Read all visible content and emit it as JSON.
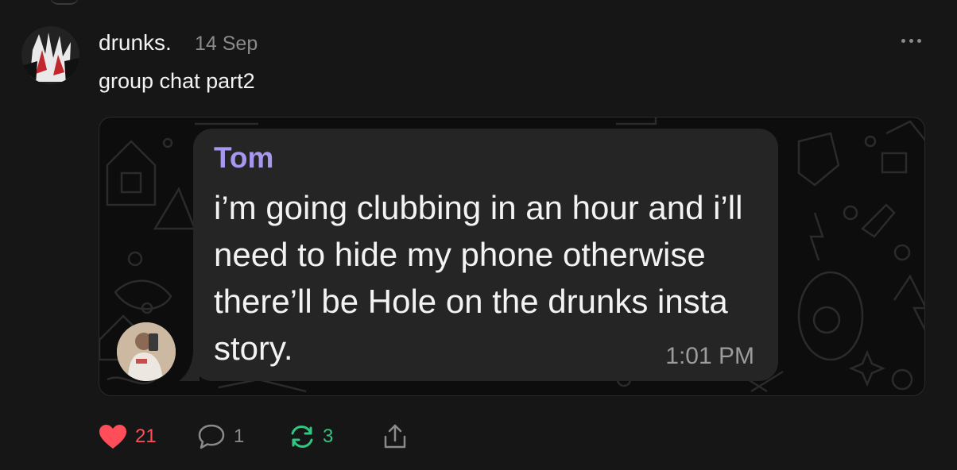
{
  "post": {
    "username": "drunks.",
    "date": "14 Sep",
    "caption": "group chat part2",
    "more_icon": "ellipsis-icon"
  },
  "chat": {
    "sender_name": "Tom",
    "message": "i’m going clubbing in an hour and i’ll need to hide my phone otherwise there’ll be Hole on the drunks insta story.",
    "time": "1:01 PM",
    "sender_name_color": "#a897ef",
    "bubble_color": "#252525"
  },
  "actions": {
    "likes": "21",
    "replies": "1",
    "reposts": "3",
    "like_icon": "heart-icon",
    "reply_icon": "comment-icon",
    "repost_icon": "repost-icon",
    "share_icon": "share-icon",
    "like_color": "#ff4d5a",
    "repost_color": "#2fc781"
  }
}
